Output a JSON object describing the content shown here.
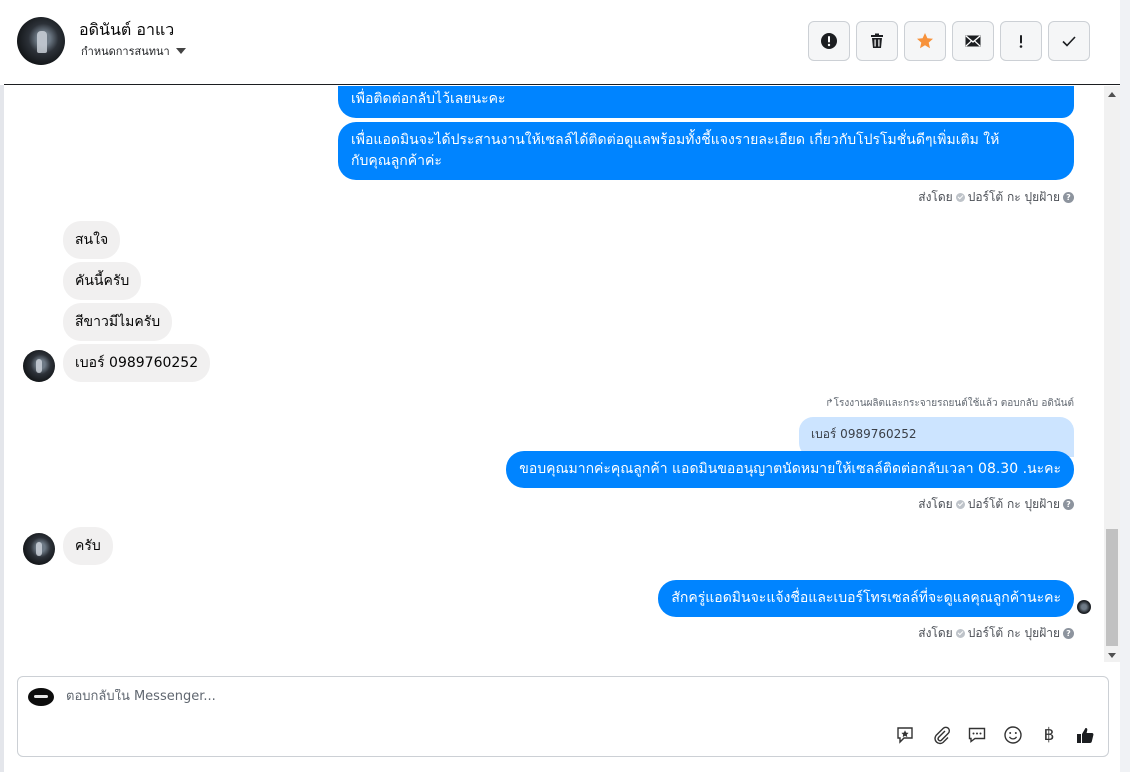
{
  "header": {
    "contact_name": "อดินันต์ อาแว",
    "status_label": "กำหนดการสนทนา",
    "actions": [
      {
        "name": "spam",
        "icon": "alert-circle-icon"
      },
      {
        "name": "delete",
        "icon": "trash-icon"
      },
      {
        "name": "star",
        "icon": "star-icon",
        "color": "#f7923b"
      },
      {
        "name": "mark-unread",
        "icon": "envelope-icon"
      },
      {
        "name": "important",
        "icon": "exclamation-icon"
      },
      {
        "name": "done",
        "icon": "checkmark-icon"
      }
    ]
  },
  "messages": {
    "out_1": "เพื่อติดต่อกลับไว้เลยนะคะ",
    "out_2_line1": "เพื่อแอดมินจะได้ประสานงานให้เซลล์ได้ติดต่อดูแลพร้อมทั้งชี้แจงรายละเอียด เกี่ยวกับโปรโมชั่นดีๆเพิ่มเติม ให้",
    "out_2_line2": "กับคุณลูกค้าค่ะ",
    "in_1": "สนใจ",
    "in_2": "คันนี้ครับ",
    "in_3": "สีขาวมีไมครับ",
    "in_4": "เบอร์ 0989760252",
    "reply_note": "โรงงานผลิตและกระจายรถยนต์ใช้แล้ว ตอบกลับ อดินันต์",
    "quoted_text": "เบอร์ 0989760252",
    "out_3": "ขอบคุณมากค่ะคุณลูกค้า แอดมินขออนุญาตนัดหมายให้เซลล์ติดต่อกลับเวลา 08.30 .นะคะ",
    "in_5": "ครับ",
    "out_4": "สักครู่แอดมินจะแจ้งชื่อและเบอร์โทรเซลล์ที่จะดูแลคุณลูกค้านะคะ",
    "sent_by_prefix": "ส่งโดย",
    "sent_by_name": "ปอร์โต้ กะ ปุยฝ้าย"
  },
  "composer": {
    "placeholder": "ตอบกลับใน Messenger...",
    "tools": [
      "chat-bubble-star-icon",
      "paperclip-icon",
      "comment-icon",
      "smiley-icon",
      "baht-icon",
      "thumbs-up-icon"
    ],
    "baht_symbol": "฿"
  },
  "colors": {
    "outgoing_bubble": "#0084ff",
    "incoming_bubble": "#f1f0f0",
    "quoted_bubble": "#cce4ff",
    "star_accent": "#f7923b"
  }
}
